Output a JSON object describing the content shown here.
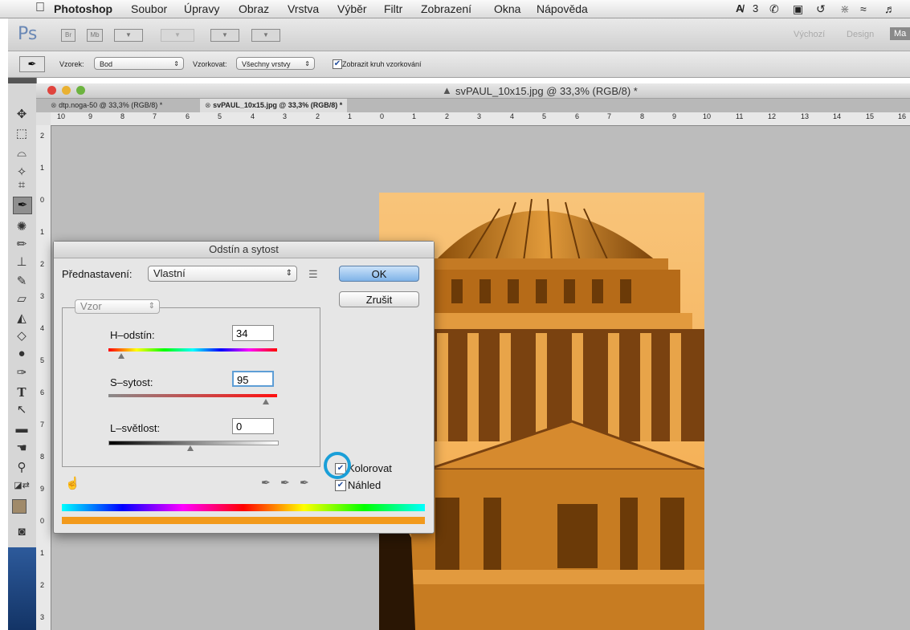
{
  "menubar": {
    "apple_icon": "apple-icon",
    "items": [
      "Photoshop",
      "Soubor",
      "Úpravy",
      "Obraz",
      "Vrstva",
      "Výběr",
      "Filtr",
      "Zobrazení",
      "Okna",
      "Nápověda"
    ],
    "tray_adobe": "3"
  },
  "appbar": {
    "logo": "Ps",
    "btn_br": "Br",
    "btn_mb": "Mb",
    "workspaces": [
      "Výchozí",
      "Design",
      "Ma"
    ]
  },
  "options": {
    "sample_label": "Vzorek:",
    "sample_value": "Bod",
    "sample_from_label": "Vzorkovat:",
    "sample_from_value": "Všechny vrstvy",
    "show_ring_label": "Zobrazit kruh vzorkování"
  },
  "document": {
    "window_title": "svPAUL_10x15.jpg @ 33,3% (RGB/8) *",
    "tabs": [
      "dtp.noga-50 @ 33,3% (RGB/8) *",
      "svPAUL_10x15.jpg @ 33,3% (RGB/8) *"
    ],
    "hruler": [
      "10",
      "9",
      "8",
      "7",
      "6",
      "5",
      "4",
      "3",
      "2",
      "1",
      "0",
      "1",
      "2",
      "3",
      "4",
      "5",
      "6",
      "7",
      "8",
      "9",
      "10",
      "11",
      "12",
      "13",
      "14",
      "15",
      "16"
    ],
    "vruler": [
      "2",
      "1",
      "0",
      "1",
      "2",
      "3",
      "4",
      "5",
      "6",
      "7",
      "8",
      "9",
      "0",
      "1",
      "2",
      "3"
    ]
  },
  "dialog": {
    "title": "Odstín a sytost",
    "preset_label": "Přednastavení:",
    "preset_value": "Vlastní",
    "channel_value": "Vzor",
    "hue_label": "H–odstín:",
    "hue_value": "34",
    "saturation_label": "S–sytost:",
    "saturation_value": "95",
    "lightness_label": "L–světlost:",
    "lightness_value": "0",
    "ok_label": "OK",
    "cancel_label": "Zrušit",
    "colorize_label": "Kolorovat",
    "preview_label": "Náhled"
  },
  "colors": {
    "tint": "#e8901c",
    "highlight_ring": "#1a9fd8"
  }
}
